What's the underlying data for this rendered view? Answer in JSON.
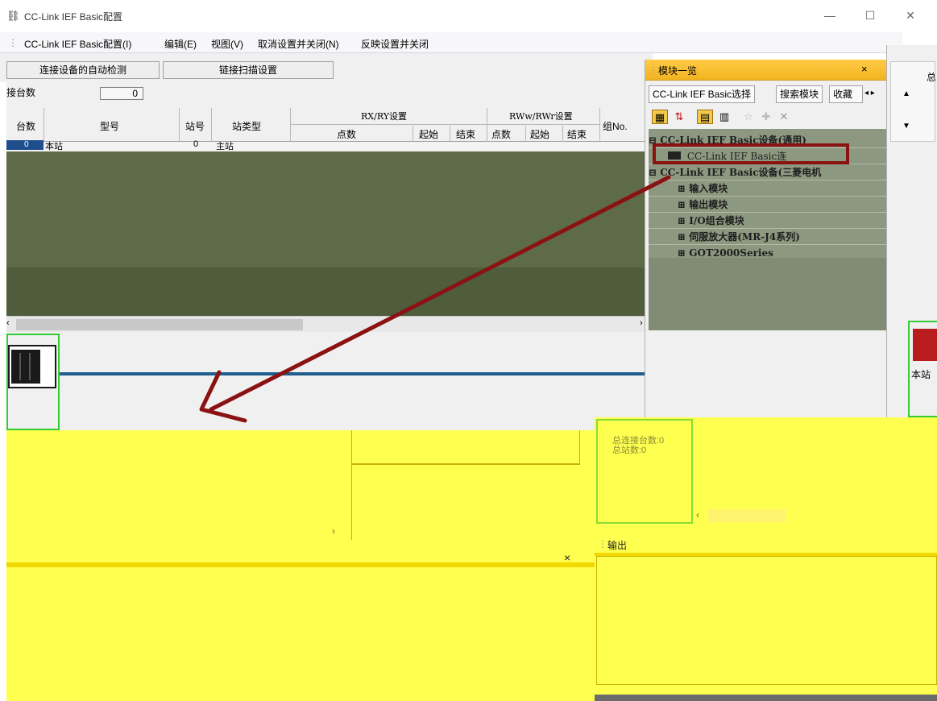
{
  "window": {
    "title": "CC-Link IEF Basic配置",
    "icon": "app-icon",
    "minimize": "—",
    "maximize": "☐",
    "close": "✕"
  },
  "menubar": {
    "items": [
      "CC-Link IEF Basic配置(I)",
      "编辑(E)",
      "视图(V)",
      "取消设置并关闭(N)",
      "反映设置并关闭"
    ]
  },
  "toolbar": {
    "auto_detect": "连接设备的自动检测",
    "link_scan": "链接扫描设置"
  },
  "grid": {
    "row_count_label": "接台数",
    "row_count_value": "0",
    "headers": {
      "count": "台数",
      "model": "型号",
      "station_no": "站号",
      "station_type": "站类型",
      "rxry": "RX/RY设置",
      "rxry_points": "点数",
      "rxry_start": "起始",
      "rxry_end": "结束",
      "rwwr": "RWw/RWr设置",
      "rwwr_points": "点数",
      "rwwr_start": "起始",
      "rwwr_end": "结束",
      "group": "组No."
    },
    "rows": [
      {
        "count": "0",
        "model": "本站",
        "station_no": "0",
        "station_type": "主站"
      }
    ]
  },
  "module_panel": {
    "title": "模块一览",
    "close": "×",
    "tabs": [
      "CC-Link IEF Basic选择",
      "搜索模块",
      "收藏"
    ],
    "tree": [
      {
        "label": "CC-Link IEF Basic设备(通用)",
        "level": 0,
        "expander": "⊟"
      },
      {
        "label": "CC-Link IEF Basic连",
        "level": 1,
        "expander": ""
      },
      {
        "label": "CC-Link IEF Basic设备(三菱电机",
        "level": 0,
        "expander": "⊟"
      },
      {
        "label": "输入模块",
        "level": 1,
        "expander": "⊞"
      },
      {
        "label": "输出模块",
        "level": 1,
        "expander": "⊞"
      },
      {
        "label": "I/O组合模块",
        "level": 1,
        "expander": "⊞"
      },
      {
        "label": "伺服放大器(MR-J4系列)",
        "level": 1,
        "expander": "⊞"
      },
      {
        "label": "GOT2000Series",
        "level": 1,
        "expander": "⊞"
      }
    ]
  },
  "right_panel": {
    "label": "总",
    "station_label": "本站"
  },
  "info": {
    "total_connected": "总连接台数:0",
    "total_stations": "总站数:0"
  },
  "output": {
    "title": "输出",
    "close": "×"
  },
  "colors": {
    "annotation": "#8b1212",
    "panel_title": "#f2b320",
    "network_line": "#1e5d8c",
    "station_border": "#33cc33",
    "yellow": "#ffff50"
  }
}
